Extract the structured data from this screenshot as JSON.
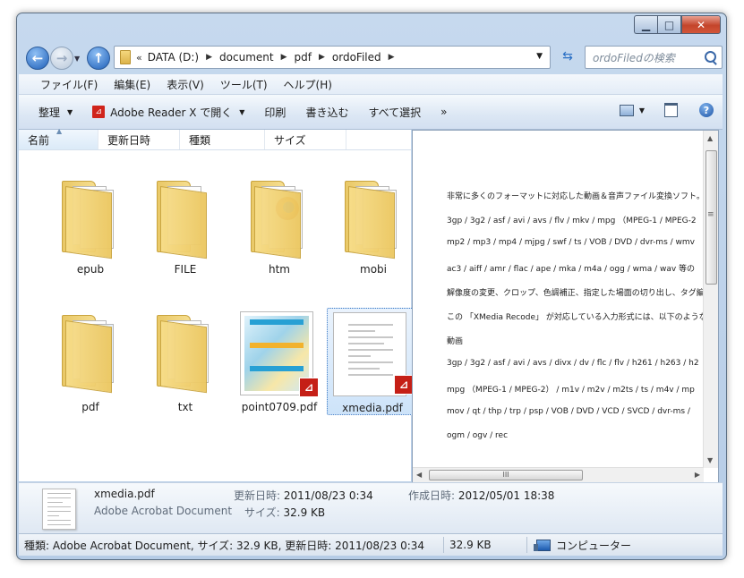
{
  "window": {
    "caption_buttons": [
      "minimize-icon",
      "maximize-icon",
      "close-icon"
    ]
  },
  "nav": {
    "address_segments": [
      "DATA (D:)",
      "document",
      "pdf",
      "ordoFiled"
    ],
    "address_overflow": "«",
    "search_placeholder": "ordoFiledの検索"
  },
  "menu": {
    "items": [
      "ファイル(F)",
      "編集(E)",
      "表示(V)",
      "ツール(T)",
      "ヘルプ(H)"
    ]
  },
  "toolbar": {
    "organize": "整理",
    "open_with": "Adobe Reader X で開く",
    "print": "印刷",
    "write": "書き込む",
    "select_all": "すべて選択",
    "more": "»"
  },
  "columns": [
    "名前",
    "更新日時",
    "種類",
    "サイズ"
  ],
  "files": [
    {
      "name": "epub",
      "kind": "folder"
    },
    {
      "name": "FILE",
      "kind": "folder"
    },
    {
      "name": "htm",
      "kind": "folder-firefox"
    },
    {
      "name": "mobi",
      "kind": "folder"
    },
    {
      "name": "pdf",
      "kind": "folder"
    },
    {
      "name": "txt",
      "kind": "folder"
    },
    {
      "name": "point0709.pdf",
      "kind": "pdf-poster"
    },
    {
      "name": "xmedia.pdf",
      "kind": "pdf-text",
      "selected": true
    }
  ],
  "preview": {
    "lines": [
      "非常に多くのフォーマットに対応した動画＆音声ファイル変換ソフト。",
      "3gp / 3g2 / asf / avi / avs / flv / mkv / mpg （MPEG-1 / MPEG-2",
      "mp2 / mp3 / mp4 / mjpg / swf / ts / VOB / DVD / dvr-ms / wmv",
      "ac3 / aiff / amr / flac / ape / mka / m4a / ogg / wma / wav 等の",
      "解像度の変更、クロップ、色調補正、指定した場面の切り出し、タグ編",
      "この 「XMedia Recode」 が対応している入力形式には、以下のような",
      "動画",
      "3gp / 3g2 / asf / avi / avs / divx / dv / flc / flv / h261 / h263 / h2",
      " mpg （MPEG-1 / MPEG-2） / m1v / m2v / m2ts / ts / m4v / mp",
      " mov / qt / thp / trp / psp / VOB / DVD / VCD / SVCD / dvr-ms /",
      " ogm / ogv / rec"
    ],
    "hscroll_grip": "III",
    "vscroll_grip": "≡"
  },
  "details": {
    "name": "xmedia.pdf",
    "type": "Adobe Acrobat Document",
    "modified_label": "更新日時:",
    "modified_value": "2011/08/23 0:34",
    "created_label": "作成日時:",
    "created_value": "2012/05/01 18:38",
    "size_label": "サイズ:",
    "size_value": "32.9 KB"
  },
  "status": {
    "summary": "種類: Adobe Acrobat Document, サイズ: 32.9 KB, 更新日時: 2011/08/23 0:34",
    "size": "32.9 KB",
    "location": "コンピューター"
  }
}
